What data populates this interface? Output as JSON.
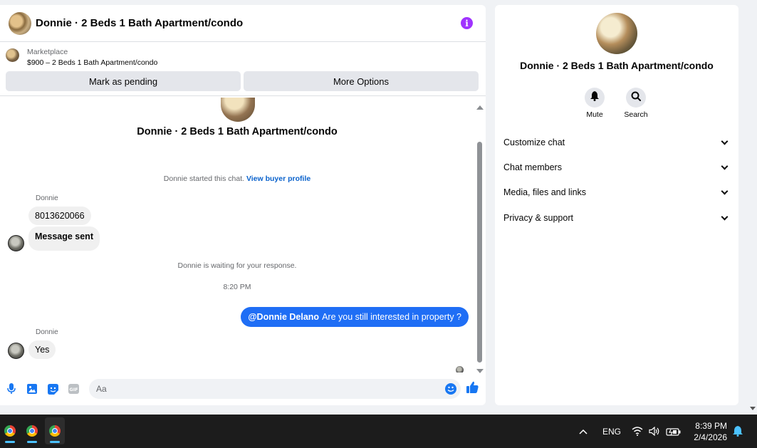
{
  "header": {
    "title": "Donnie · 2 Beds 1 Bath Apartment/condo",
    "info_icon": "info-icon"
  },
  "listing": {
    "category": "Marketplace",
    "price_title": "$900 – 2 Beds 1 Bath Apartment/condo"
  },
  "actions": {
    "mark_pending": "Mark as pending",
    "more_options": "More Options"
  },
  "conversation": {
    "title": "Donnie · 2 Beds 1 Bath Apartment/condo",
    "started_text": "Donnie started this chat.",
    "view_profile": "View buyer profile",
    "group1_sender": "Donnie",
    "group1_msg1": "8013620066",
    "group1_msg2": "Message sent",
    "waiting_text": "Donnie is waiting for your response.",
    "timestamp": "8:20 PM",
    "outgoing_mention": "@Donnie Delano",
    "outgoing_text": "Are you still interested in property ?",
    "group2_sender": "Donnie",
    "group2_msg1": "Yes"
  },
  "composer": {
    "placeholder": "Aa"
  },
  "info_panel": {
    "title": "Donnie · 2 Beds 1 Bath Apartment/condo",
    "mute_label": "Mute",
    "search_label": "Search",
    "sections": [
      "Customize chat",
      "Chat members",
      "Media, files and links",
      "Privacy & support"
    ]
  },
  "taskbar": {
    "lang": "ENG",
    "time": "8:39 PM",
    "date": "2/4/2026"
  },
  "colors": {
    "accent": "#1f6ef5",
    "info": "#a033ff",
    "taskbar": "#1c1c1c"
  }
}
